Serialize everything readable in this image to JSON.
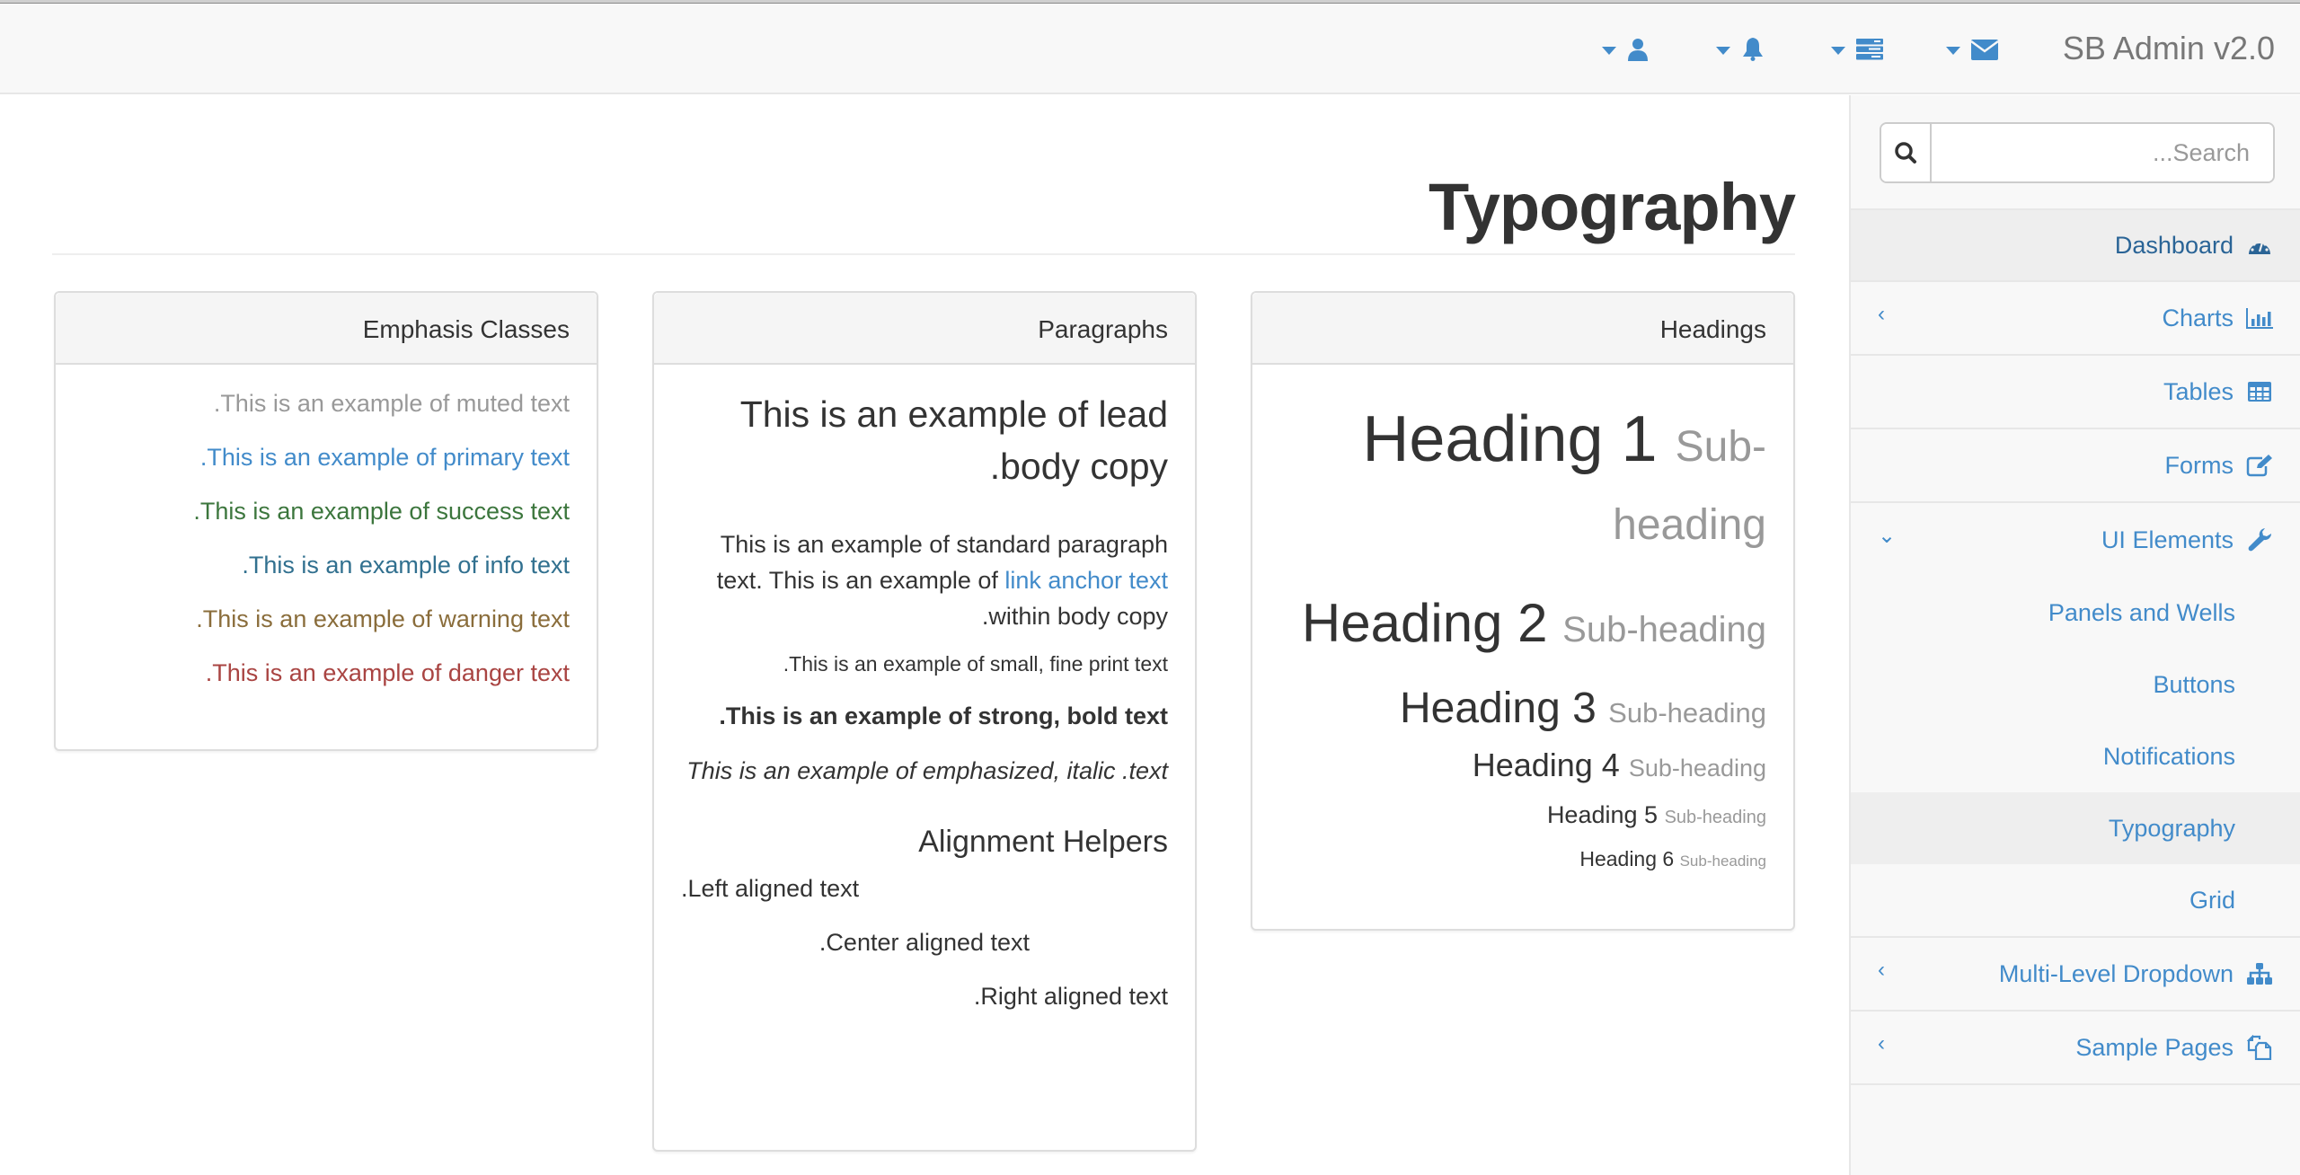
{
  "navbar": {
    "brand": "SB Admin v2.0",
    "dropdowns": [
      {
        "icon": "envelope-icon",
        "name": "messages-dropdown"
      },
      {
        "icon": "tasks-icon",
        "name": "tasks-dropdown"
      },
      {
        "icon": "bell-icon",
        "name": "alerts-dropdown"
      },
      {
        "icon": "user-icon",
        "name": "user-dropdown"
      }
    ]
  },
  "page": {
    "title": "Typography"
  },
  "panels": {
    "emphasis": {
      "title": "Emphasis Classes",
      "lines": [
        {
          "text": ".This is an example of muted text",
          "color": "#999999"
        },
        {
          "text": ".This is an example of primary text",
          "color": "#428bca"
        },
        {
          "text": ".This is an example of success text",
          "color": "#3c763d"
        },
        {
          "text": ".This is an example of info text",
          "color": "#31708f"
        },
        {
          "text": ".This is an example of warning text",
          "color": "#8a6d3b"
        },
        {
          "text": ".This is an example of danger text",
          "color": "#a94442"
        }
      ]
    },
    "paragraphs": {
      "title": "Paragraphs",
      "lead": "This is an example of lead .body copy",
      "standard_before": "This is an example of standard paragraph text. This is an example of ",
      "link": "link anchor text",
      "standard_after": " .within body copy",
      "small": ".This is an example of small, fine print text",
      "strong": ".This is an example of strong, bold text",
      "emphasized": "This is an example of emphasized, italic .text",
      "alignment_heading": "Alignment Helpers",
      "left": ".Left aligned text",
      "center": ".Center aligned text",
      "right": ".Right aligned text"
    },
    "headings": {
      "title": "Headings",
      "items": [
        {
          "heading": "Heading 1",
          "sub": "Sub-heading"
        },
        {
          "heading": "Heading 2",
          "sub": "Sub-heading"
        },
        {
          "heading": "Heading 3",
          "sub": "Sub-heading"
        },
        {
          "heading": "Heading 4",
          "sub": "Sub-heading"
        },
        {
          "heading": "Heading 5",
          "sub": "Sub-heading"
        },
        {
          "heading": "Heading 6",
          "sub": "Sub-heading"
        }
      ]
    }
  },
  "sidebar": {
    "search_placeholder": "...Search",
    "items": [
      {
        "label": "Dashboard",
        "icon": "dashboard-icon",
        "active": true
      },
      {
        "label": "Charts",
        "icon": "bar-chart-icon",
        "arrow": "‹"
      },
      {
        "label": "Tables",
        "icon": "table-icon"
      },
      {
        "label": "Forms",
        "icon": "edit-icon"
      },
      {
        "label": "UI Elements",
        "icon": "wrench-icon",
        "arrow": "⌄",
        "expanded": true,
        "children": [
          {
            "label": "Panels and Wells"
          },
          {
            "label": "Buttons"
          },
          {
            "label": "Notifications"
          },
          {
            "label": "Typography",
            "active": true
          },
          {
            "label": "Grid"
          }
        ]
      },
      {
        "label": "Multi-Level Dropdown",
        "icon": "sitemap-icon",
        "arrow": "‹"
      },
      {
        "label": "Sample Pages",
        "icon": "files-icon",
        "arrow": "‹"
      }
    ]
  },
  "colors": {
    "primary": "#428bca",
    "primary_dark": "#2a6496",
    "muted": "#999999",
    "success": "#3c763d",
    "info": "#31708f",
    "warning": "#8a6d3b",
    "danger": "#a94442"
  }
}
